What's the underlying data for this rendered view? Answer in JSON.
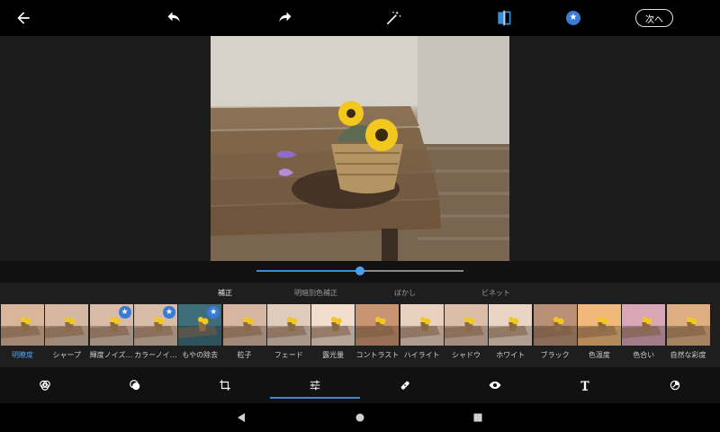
{
  "topbar": {
    "back_icon": "back-arrow-icon",
    "undo_icon": "undo-icon",
    "redo_icon": "redo-icon",
    "auto_fix_icon": "magic-wand-icon",
    "compare_icon": "compare-icon",
    "premium_icon": "premium-star-icon",
    "next_label": "次へ"
  },
  "slider": {
    "value": 0.5
  },
  "categories": [
    {
      "label": "補正",
      "active": true
    },
    {
      "label": "明暗別色補正",
      "active": false
    },
    {
      "label": "ぼかし",
      "active": false
    },
    {
      "label": "ビネット",
      "active": false
    }
  ],
  "adjustments": [
    {
      "label": "明瞭度",
      "premium": false,
      "active": true,
      "tone": "#d9b59a"
    },
    {
      "label": "シャープ",
      "premium": false,
      "active": false,
      "tone": "#d6b8a2"
    },
    {
      "label": "輝度ノイズ…",
      "premium": true,
      "active": false,
      "tone": "#d9bca8"
    },
    {
      "label": "カラーノイ…",
      "premium": true,
      "active": false,
      "tone": "#d8bca7"
    },
    {
      "label": "もやの除去",
      "premium": true,
      "active": false,
      "tone": "#3d6e7a"
    },
    {
      "label": "粒子",
      "premium": false,
      "active": false,
      "tone": "#d6b6a0"
    },
    {
      "label": "フェード",
      "premium": false,
      "active": false,
      "tone": "#e1cbbb"
    },
    {
      "label": "露光量",
      "premium": false,
      "active": false,
      "tone": "#f2dccc"
    },
    {
      "label": "コントラスト",
      "premium": false,
      "active": false,
      "tone": "#c99472"
    },
    {
      "label": "ハイライト",
      "premium": false,
      "active": false,
      "tone": "#e9d1bf"
    },
    {
      "label": "シャドウ",
      "premium": false,
      "active": false,
      "tone": "#dbbda8"
    },
    {
      "label": "ホワイト",
      "premium": false,
      "active": false,
      "tone": "#ead4c4"
    },
    {
      "label": "ブラック",
      "premium": false,
      "active": false,
      "tone": "#b98f76"
    },
    {
      "label": "色温度",
      "premium": false,
      "active": false,
      "tone": "#f0b87a"
    },
    {
      "label": "色合い",
      "premium": false,
      "active": false,
      "tone": "#d9a6b6"
    },
    {
      "label": "自然な彩度",
      "premium": false,
      "active": false,
      "tone": "#dcae82"
    }
  ],
  "tools": [
    {
      "icon": "color-mix-icon"
    },
    {
      "icon": "looks-icon"
    },
    {
      "icon": "crop-icon"
    },
    {
      "icon": "adjust-sliders-icon",
      "active": true
    },
    {
      "icon": "healing-icon"
    },
    {
      "icon": "eye-icon"
    },
    {
      "icon": "text-icon"
    },
    {
      "icon": "frame-icon"
    }
  ],
  "nav": {
    "back_icon": "nav-back-icon",
    "home_icon": "nav-home-icon",
    "recents_icon": "nav-recents-icon"
  },
  "colors": {
    "accent": "#3a8bd8",
    "badge": "#3a7bd5",
    "flower": "#f2c81e"
  }
}
